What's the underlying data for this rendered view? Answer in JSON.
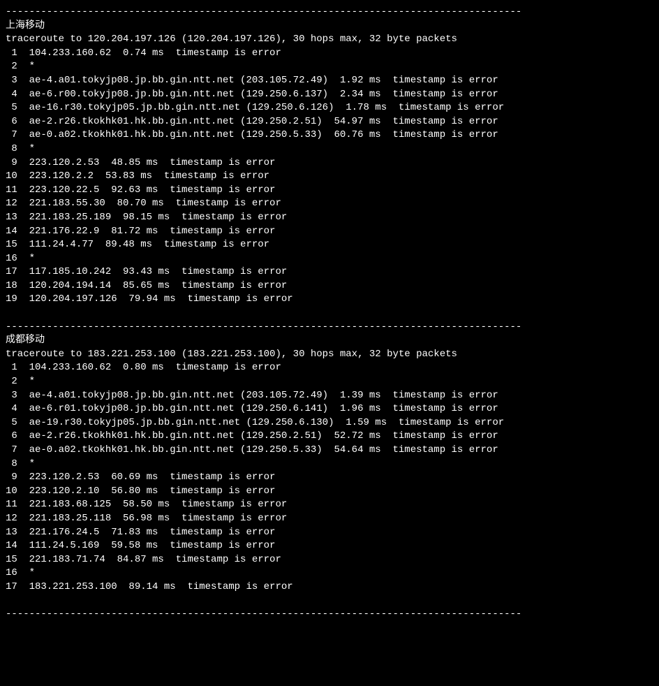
{
  "sections": [
    {
      "divider": "----------------------------------------------------------------------------------------",
      "title": "上海移动",
      "traceroute_header": "traceroute to 120.204.197.126 (120.204.197.126), 30 hops max, 32 byte packets",
      "hops": [
        " 1  104.233.160.62  0.74 ms  timestamp is error",
        " 2  *",
        " 3  ae-4.a01.tokyjp08.jp.bb.gin.ntt.net (203.105.72.49)  1.92 ms  timestamp is error",
        " 4  ae-6.r00.tokyjp08.jp.bb.gin.ntt.net (129.250.6.137)  2.34 ms  timestamp is error",
        " 5  ae-16.r30.tokyjp05.jp.bb.gin.ntt.net (129.250.6.126)  1.78 ms  timestamp is error",
        " 6  ae-2.r26.tkokhk01.hk.bb.gin.ntt.net (129.250.2.51)  54.97 ms  timestamp is error",
        " 7  ae-0.a02.tkokhk01.hk.bb.gin.ntt.net (129.250.5.33)  60.76 ms  timestamp is error",
        " 8  *",
        " 9  223.120.2.53  48.85 ms  timestamp is error",
        "10  223.120.2.2  53.83 ms  timestamp is error",
        "11  223.120.22.5  92.63 ms  timestamp is error",
        "12  221.183.55.30  80.70 ms  timestamp is error",
        "13  221.183.25.189  98.15 ms  timestamp is error",
        "14  221.176.22.9  81.72 ms  timestamp is error",
        "15  111.24.4.77  89.48 ms  timestamp is error",
        "16  *",
        "17  117.185.10.242  93.43 ms  timestamp is error",
        "18  120.204.194.14  85.65 ms  timestamp is error",
        "19  120.204.197.126  79.94 ms  timestamp is error"
      ]
    },
    {
      "divider": "----------------------------------------------------------------------------------------",
      "title": "成都移动",
      "traceroute_header": "traceroute to 183.221.253.100 (183.221.253.100), 30 hops max, 32 byte packets",
      "hops": [
        " 1  104.233.160.62  0.80 ms  timestamp is error",
        " 2  *",
        " 3  ae-4.a01.tokyjp08.jp.bb.gin.ntt.net (203.105.72.49)  1.39 ms  timestamp is error",
        " 4  ae-6.r01.tokyjp08.jp.bb.gin.ntt.net (129.250.6.141)  1.96 ms  timestamp is error",
        " 5  ae-19.r30.tokyjp05.jp.bb.gin.ntt.net (129.250.6.130)  1.59 ms  timestamp is error",
        " 6  ae-2.r26.tkokhk01.hk.bb.gin.ntt.net (129.250.2.51)  52.72 ms  timestamp is error",
        " 7  ae-0.a02.tkokhk01.hk.bb.gin.ntt.net (129.250.5.33)  54.64 ms  timestamp is error",
        " 8  *",
        " 9  223.120.2.53  60.69 ms  timestamp is error",
        "10  223.120.2.10  56.80 ms  timestamp is error",
        "11  221.183.68.125  58.50 ms  timestamp is error",
        "12  221.183.25.118  56.98 ms  timestamp is error",
        "13  221.176.24.5  71.83 ms  timestamp is error",
        "14  111.24.5.169  59.58 ms  timestamp is error",
        "15  221.183.71.74  84.87 ms  timestamp is error",
        "16  *",
        "17  183.221.253.100  89.14 ms  timestamp is error"
      ]
    }
  ],
  "final_divider": "----------------------------------------------------------------------------------------"
}
